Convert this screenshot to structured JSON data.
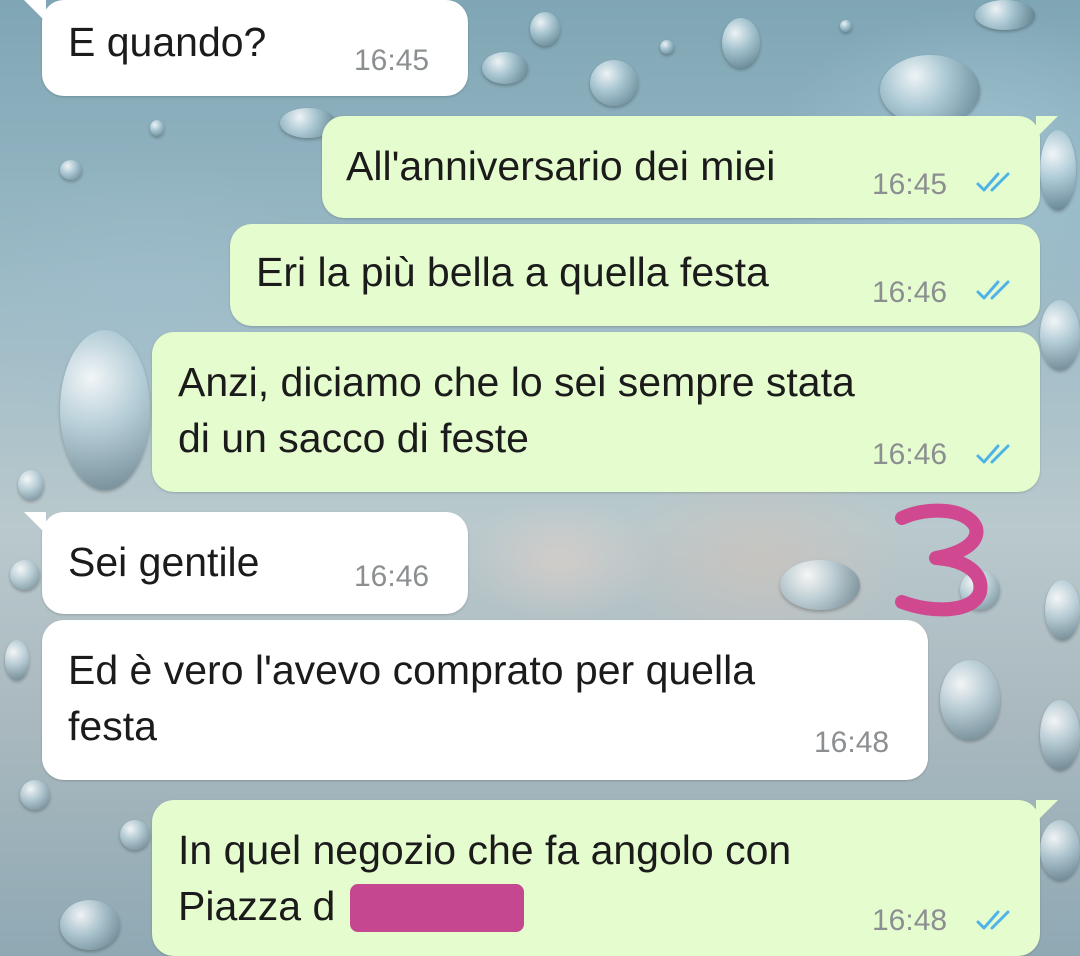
{
  "messages": [
    {
      "direction": "incoming",
      "lines": [
        "E quando?"
      ],
      "time": "16:45"
    },
    {
      "direction": "outgoing",
      "lines": [
        "All'anniversario dei miei"
      ],
      "time": "16:45",
      "status": "read-ticks-icon"
    },
    {
      "direction": "outgoing",
      "lines": [
        "Eri la più bella a quella festa"
      ],
      "time": "16:46",
      "status": "read-ticks-icon"
    },
    {
      "direction": "outgoing",
      "lines": [
        "Anzi, diciamo che lo sei sempre stata",
        "di un sacco di feste"
      ],
      "time": "16:46",
      "status": "read-ticks-icon"
    },
    {
      "direction": "incoming",
      "lines": [
        "Sei gentile"
      ],
      "time": "16:46"
    },
    {
      "direction": "incoming",
      "lines": [
        "Ed è vero l'avevo comprato per quella",
        "festa"
      ],
      "time": "16:48"
    },
    {
      "direction": "outgoing",
      "lines": [
        "In quel negozio che fa angolo con",
        "Piazza d"
      ],
      "time": "16:48",
      "status": "read-ticks-icon"
    }
  ],
  "annotation": {
    "text": "3",
    "color": "#d0488f"
  },
  "colors": {
    "incoming_bubble": "#ffffff",
    "outgoing_bubble": "#e5fccf",
    "read_ticks": "#4fb3e8",
    "redaction": "#c5478f"
  }
}
